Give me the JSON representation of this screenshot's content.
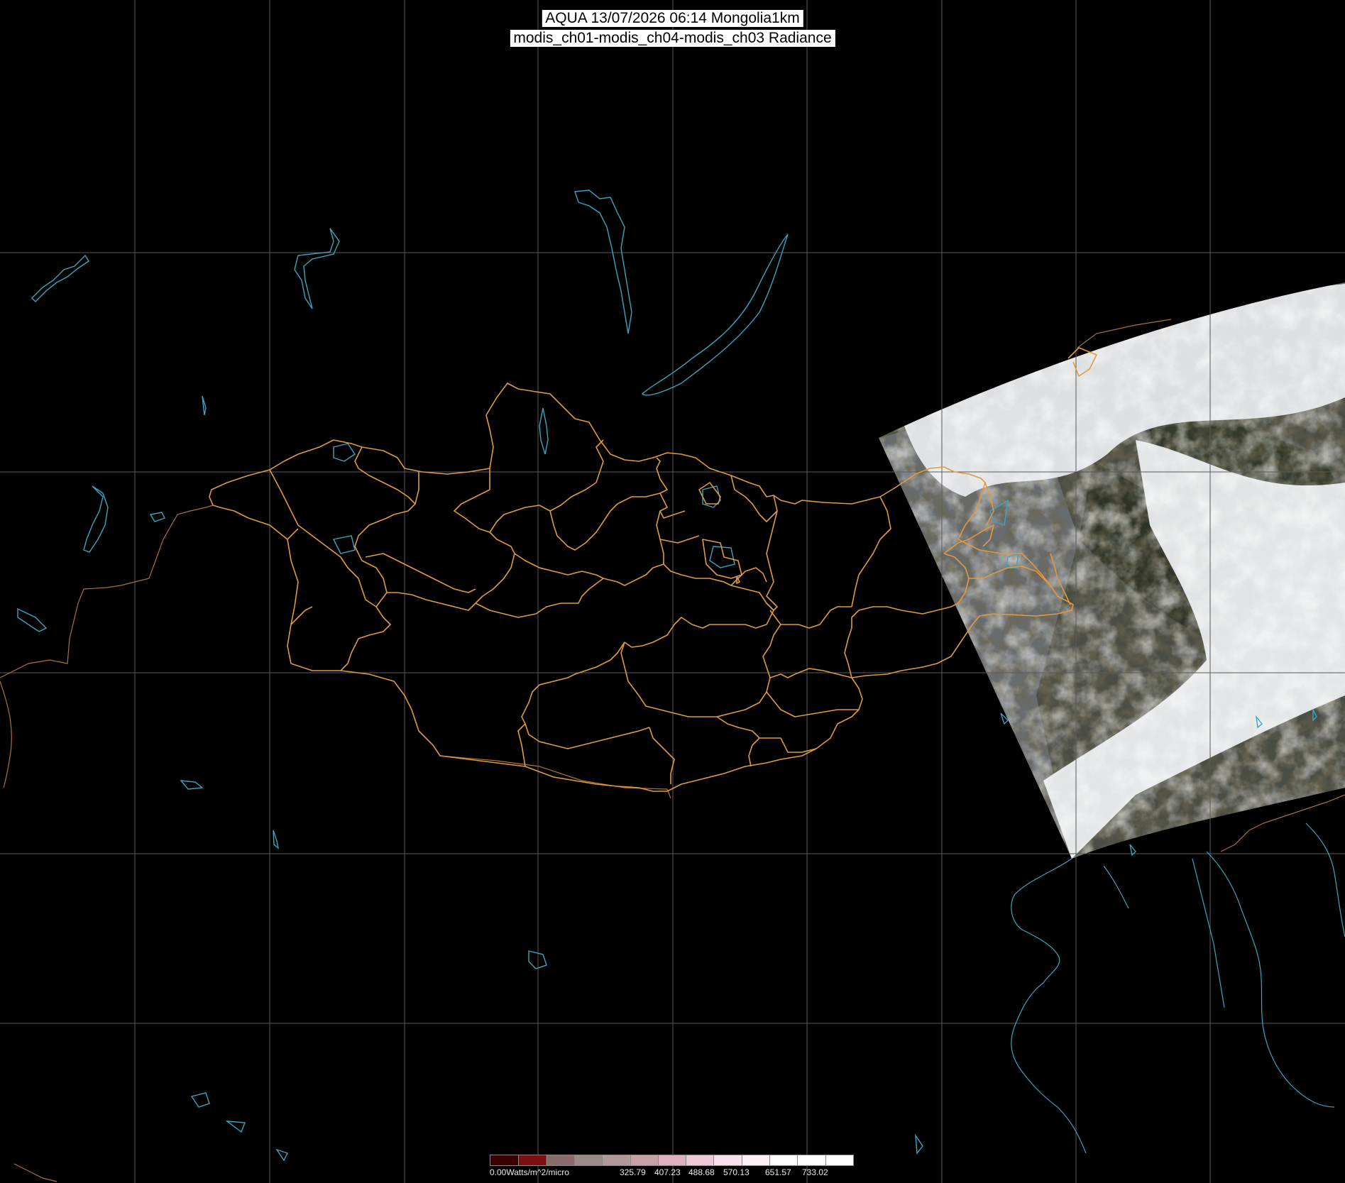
{
  "title": {
    "line1": "AQUA 13/07/2026 06:14 Mongolia1km",
    "line2": "modis_ch01-modis_ch04-modis_ch03 Radiance"
  },
  "legend": {
    "unit_label": "0.00Watts/m^2/micro",
    "ticks": [
      "325.79",
      "407.23",
      "488.68",
      "570.13",
      "651.57",
      "733.02"
    ],
    "colors": [
      "#3a0000",
      "#7a1010",
      "#8a6a6a",
      "#9a8a8a",
      "#b09898",
      "#c8a0a8",
      "#e0b0c0",
      "#f0c8d8",
      "#f8e0ec",
      "#fff0f8",
      "#ffffff",
      "#ffffff",
      "#ffffff"
    ]
  },
  "colors": {
    "background": "#000000",
    "grid": "#5a5a5a",
    "admin_borders": "#e09a40",
    "coast_water": "#3aa6c0",
    "international_borders": "#b0703a",
    "cloud": "#f2f4f6",
    "land": "#3a3f30"
  }
}
